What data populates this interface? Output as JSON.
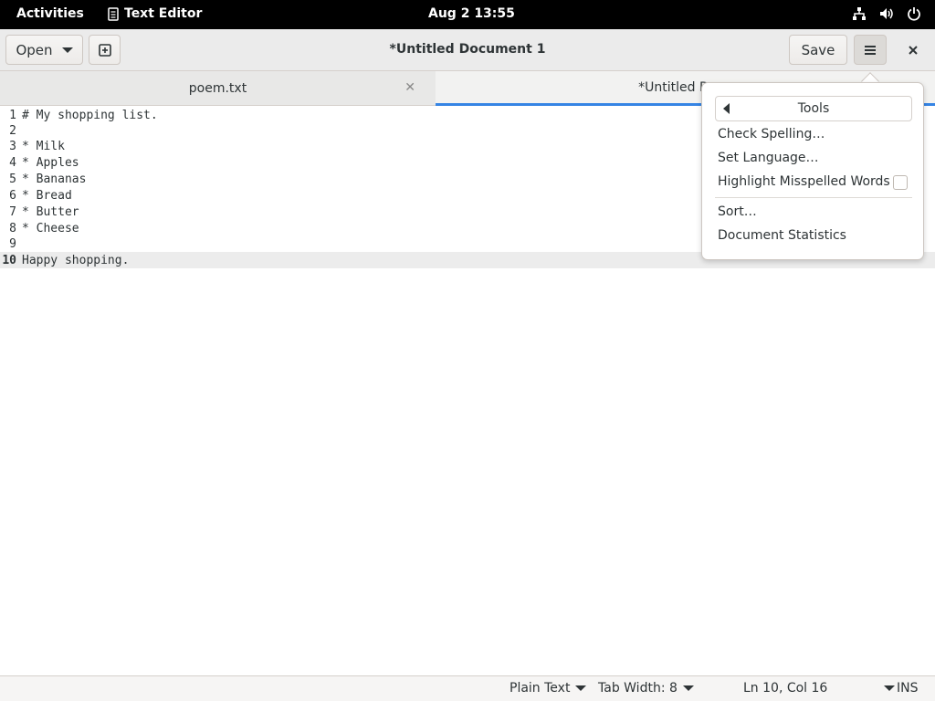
{
  "topbar": {
    "activities": "Activities",
    "app_name": "Text Editor",
    "app_icon": "document-icon",
    "clock": "Aug 2  13:55",
    "tray_icons": [
      "network-icon",
      "volume-icon",
      "power-icon"
    ]
  },
  "header": {
    "open_label": "Open",
    "title": "*Untitled Document 1",
    "save_label": "Save",
    "newtab_icon": "new-tab-icon",
    "menu_icon": "hamburger-icon",
    "close_icon": "close-icon"
  },
  "tabs": [
    {
      "label": "poem.txt"
    },
    {
      "label": "*Untitled Docu"
    }
  ],
  "editor": {
    "lines": [
      {
        "num": "1",
        "text": "# My shopping list."
      },
      {
        "num": "2",
        "text": ""
      },
      {
        "num": "3",
        "text": "* Milk"
      },
      {
        "num": "4",
        "text": "* Apples"
      },
      {
        "num": "5",
        "text": "* Bananas"
      },
      {
        "num": "6",
        "text": "* Bread"
      },
      {
        "num": "7",
        "text": "* Butter"
      },
      {
        "num": "8",
        "text": "* Cheese"
      },
      {
        "num": "9",
        "text": ""
      },
      {
        "num": "10",
        "text": "Happy shopping."
      }
    ]
  },
  "statusbar": {
    "language": "Plain Text",
    "tab_width": "Tab Width: 8",
    "position": "Ln 10, Col 16",
    "mode": "INS"
  },
  "menu": {
    "header": "Tools",
    "check_spelling": "Check Spelling…",
    "set_language": "Set Language…",
    "highlight": "Highlight Misspelled Words",
    "highlight_checked": false,
    "sort": "Sort…",
    "stats": "Document Statistics"
  },
  "colors": {
    "accent": "#3584e4",
    "topbar": "#000000"
  }
}
